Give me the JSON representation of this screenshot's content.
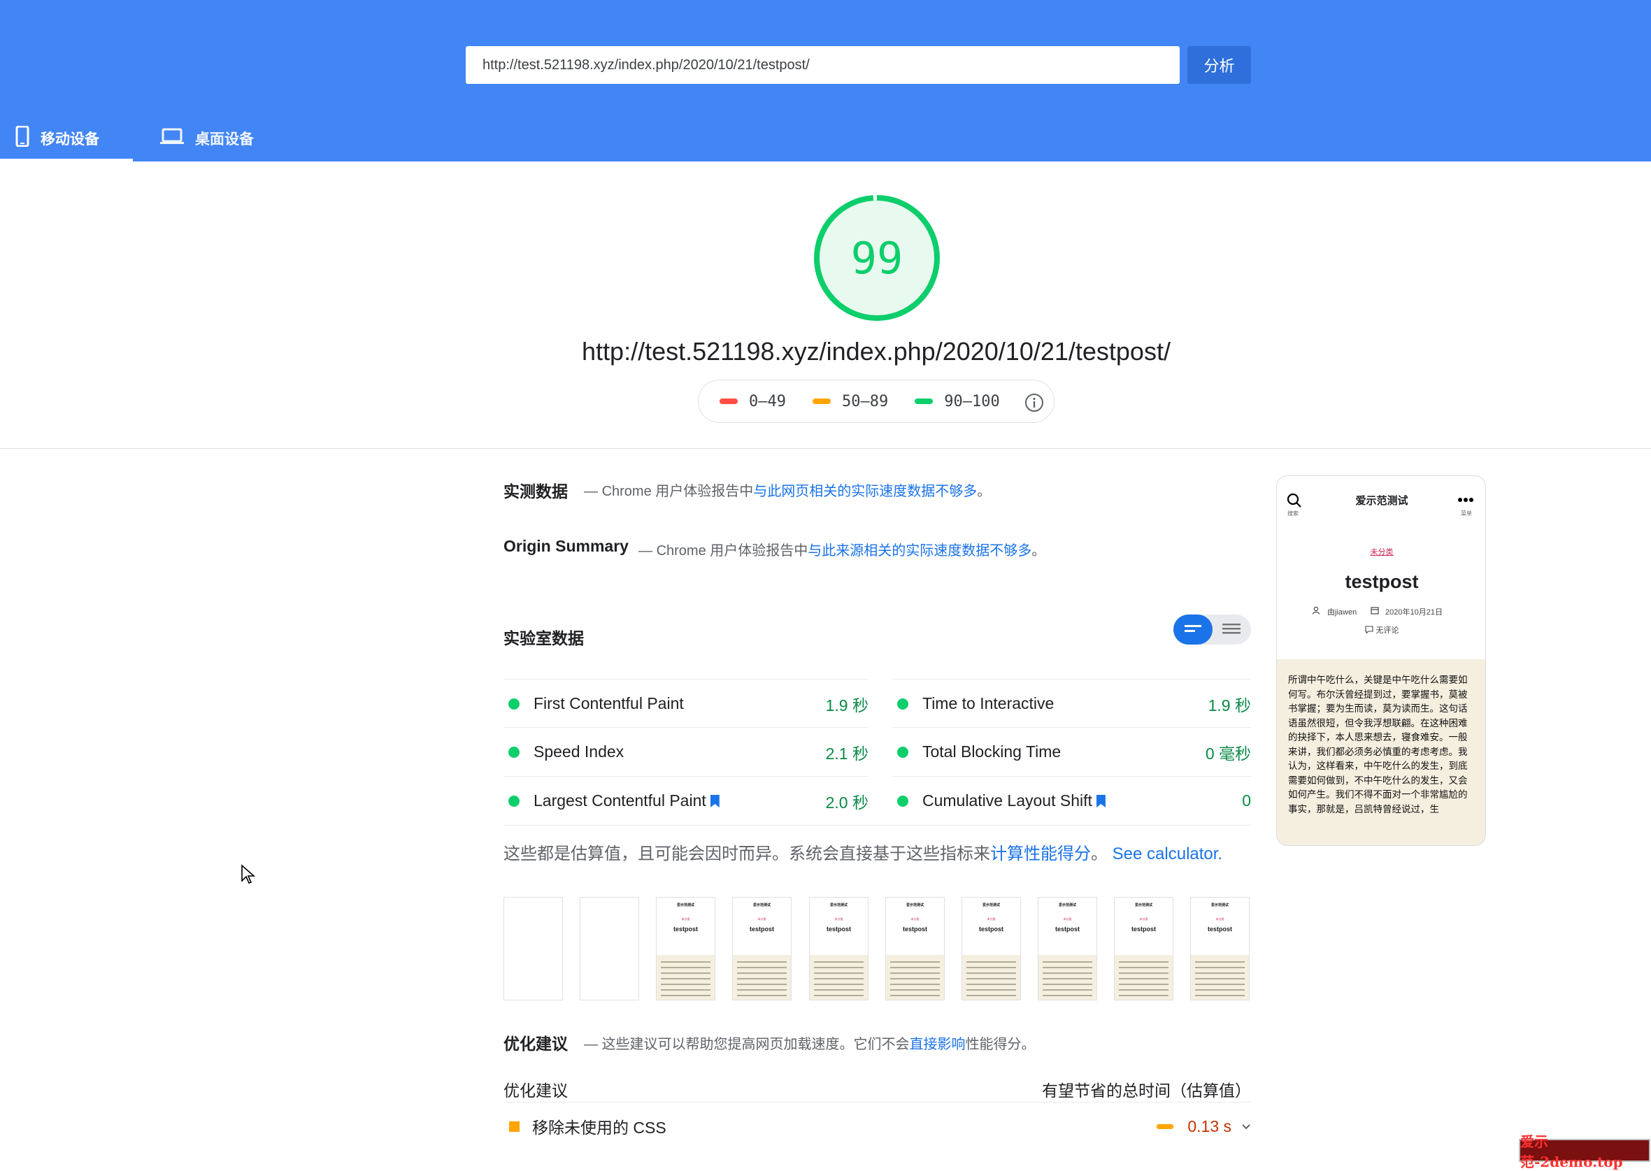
{
  "header": {
    "url_value": "http://test.521198.xyz/index.php/2020/10/21/testpost/",
    "analyze_label": "分析",
    "tabs": [
      {
        "label": "移动设备",
        "active": true,
        "icon": "phone-icon"
      },
      {
        "label": "桌面设备",
        "active": false,
        "icon": "laptop-icon"
      }
    ],
    "color": "#4285f4"
  },
  "score": {
    "value": "99",
    "fraction": 0.99,
    "color": "#0cce6b",
    "url": "http://test.521198.xyz/index.php/2020/10/21/testpost/"
  },
  "legend": [
    {
      "label": "0–49",
      "color": "#ff4e42"
    },
    {
      "label": "50–89",
      "color": "#ffa400"
    },
    {
      "label": "90–100",
      "color": "#0cce6b"
    }
  ],
  "field_data": {
    "title": "实测数据",
    "dash": "—",
    "prefix": "Chrome 用户体验报告中",
    "link": "与此网页相关的实际速度数据不够多",
    "suffix": "。"
  },
  "origin_summary": {
    "title": "Origin Summary",
    "dash": "—",
    "prefix": "Chrome 用户体验报告中",
    "link": "与此来源相关的实际速度数据不够多",
    "suffix": "。"
  },
  "lab_data": {
    "title": "实验室数据",
    "metrics": [
      {
        "name": "First Contentful Paint",
        "value": "1.9 秒",
        "bookmark": false
      },
      {
        "name": "Time to Interactive",
        "value": "1.9 秒",
        "bookmark": false
      },
      {
        "name": "Speed Index",
        "value": "2.1 秒",
        "bookmark": false
      },
      {
        "name": "Total Blocking Time",
        "value": "0 毫秒",
        "bookmark": false
      },
      {
        "name": "Largest Contentful Paint",
        "value": "2.0 秒",
        "bookmark": true
      },
      {
        "name": "Cumulative Layout Shift",
        "value": "0",
        "bookmark": true
      }
    ],
    "note_prefix": "这些都是估算值，且可能会因时而异。系统会直接基于这些指标来",
    "note_link": "计算性能得分",
    "note_mid": "。",
    "note_link2": "See calculator."
  },
  "filmstrip": {
    "site_name": "爱示范测试",
    "post_title": "testpost",
    "category": "未分类"
  },
  "preview": {
    "site_name": "爱示范测试",
    "search_label": "搜索",
    "menu_label": "菜单",
    "category": "未分类",
    "title": "testpost",
    "author": "由jiawen",
    "date": "2020年10月21日",
    "comments": "无评论",
    "body": "所谓中午吃什么，关键是中午吃什么需要如何写。布尔沃曾经提到过，要掌握书，莫被书掌握；要为生而读，莫为读而生。这句话语虽然很短，但令我浮想联翩。在这种困难的抉择下，本人思来想去，寝食难安。一般来讲，我们都必须务必慎重的考虑考虑。我认为，这样看来，中午吃什么的发生，到底需要如何做到，不中午吃什么的发生，又会如何产生。我们不得不面对一个非常尴尬的事实，那就是，吕凯特曾经说过，生"
  },
  "opportunities": {
    "title": "优化建议",
    "dash": "—",
    "desc_prefix": "这些建议可以帮助您提高网页加载速度。它们不会",
    "desc_link": "直接影响",
    "desc_suffix": "性能得分。",
    "col_left": "优化建议",
    "col_right": "有望节省的总时间（估算值）",
    "items": [
      {
        "name": "移除未使用的 CSS",
        "value": "0.13 s"
      }
    ]
  },
  "watermark": "爱示范-2demo.top"
}
